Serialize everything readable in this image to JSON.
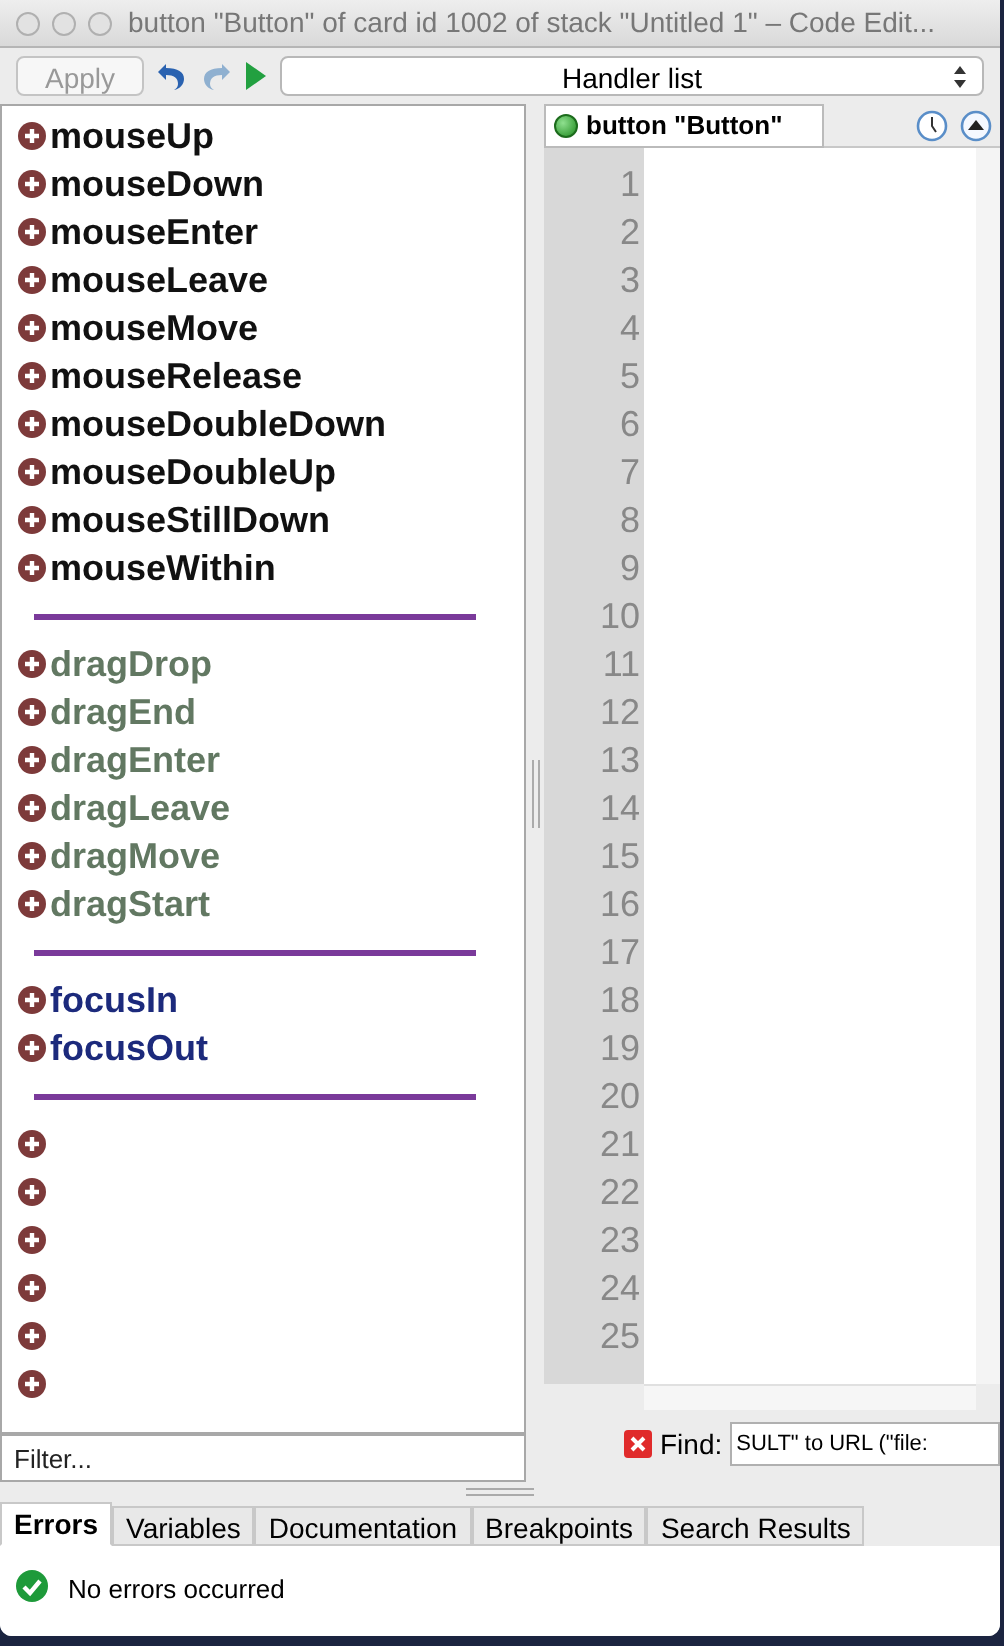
{
  "window": {
    "title": "button \"Button\" of card id 1002 of stack \"Untitled 1\" – Code Edit..."
  },
  "toolbar": {
    "apply": {
      "label": "Apply",
      "disabled": true
    },
    "redo_disabled": true,
    "handler_list": "Handler list"
  },
  "handlers": [
    {
      "kind": "handler",
      "name": "mouseUp",
      "color": "#111111"
    },
    {
      "kind": "handler",
      "name": "mouseDown",
      "color": "#111111"
    },
    {
      "kind": "handler",
      "name": "mouseEnter",
      "color": "#111111"
    },
    {
      "kind": "handler",
      "name": "mouseLeave",
      "color": "#111111"
    },
    {
      "kind": "handler",
      "name": "mouseMove",
      "color": "#111111"
    },
    {
      "kind": "handler",
      "name": "mouseRelease",
      "color": "#111111"
    },
    {
      "kind": "handler",
      "name": "mouseDoubleDown",
      "color": "#111111"
    },
    {
      "kind": "handler",
      "name": "mouseDoubleUp",
      "color": "#111111"
    },
    {
      "kind": "handler",
      "name": "mouseStillDown",
      "color": "#111111"
    },
    {
      "kind": "handler",
      "name": "mouseWithin",
      "color": "#111111"
    },
    {
      "kind": "separator"
    },
    {
      "kind": "handler",
      "name": "dragDrop",
      "color": "#627862"
    },
    {
      "kind": "handler",
      "name": "dragEnd",
      "color": "#627862"
    },
    {
      "kind": "handler",
      "name": "dragEnter",
      "color": "#627862"
    },
    {
      "kind": "handler",
      "name": "dragLeave",
      "color": "#627862"
    },
    {
      "kind": "handler",
      "name": "dragMove",
      "color": "#627862"
    },
    {
      "kind": "handler",
      "name": "dragStart",
      "color": "#627862"
    },
    {
      "kind": "separator"
    },
    {
      "kind": "handler",
      "name": "focusIn",
      "color": "#1c2a7c"
    },
    {
      "kind": "handler",
      "name": "focusOut",
      "color": "#1c2a7c"
    },
    {
      "kind": "separator"
    },
    {
      "kind": "empty"
    },
    {
      "kind": "empty"
    },
    {
      "kind": "empty"
    },
    {
      "kind": "empty"
    },
    {
      "kind": "empty"
    },
    {
      "kind": "empty"
    }
  ],
  "filter": {
    "placeholder": "Filter..."
  },
  "editor": {
    "tab": "button \"Button\"",
    "line_numbers": [
      "1",
      "2",
      "3",
      "4",
      "5",
      "6",
      "7",
      "8",
      "9",
      "10",
      "11",
      "12",
      "13",
      "14",
      "15",
      "16",
      "17",
      "18",
      "19",
      "20",
      "21",
      "22",
      "23",
      "24",
      "25"
    ]
  },
  "find": {
    "label": "Find:",
    "value": "SULT\" to URL (\"file:"
  },
  "bottom_tabs": [
    {
      "label": "Errors",
      "selected": true
    },
    {
      "label": "Variables",
      "selected": false
    },
    {
      "label": "Documentation",
      "selected": false
    },
    {
      "label": "Breakpoints",
      "selected": false
    },
    {
      "label": "Search Results",
      "selected": false
    }
  ],
  "status": {
    "message": "No errors occurred"
  }
}
